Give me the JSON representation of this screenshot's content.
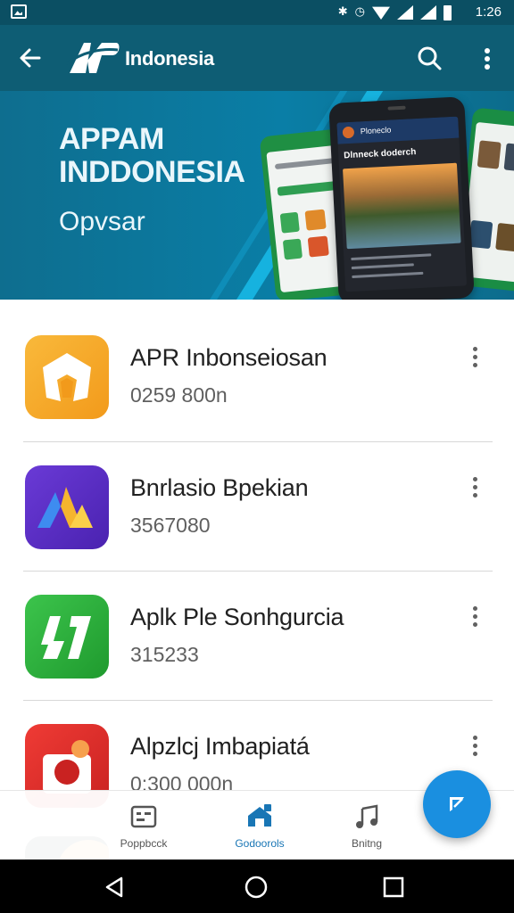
{
  "status_bar": {
    "time": "1:26",
    "icons": [
      "bluetooth-icon",
      "alarm-icon",
      "wifi-icon",
      "signal-icon",
      "battery-icon"
    ]
  },
  "app_bar": {
    "title": "Indonesia",
    "logo_text": "AP",
    "back_icon": "back-arrow-icon",
    "search_icon": "search-icon",
    "overflow_icon": "more-vert-icon"
  },
  "banner": {
    "title_line1": "APPAM",
    "title_line2": "INDDONESIA",
    "subtitle": "Opvsar",
    "phone_header": "Ploneclo",
    "phone_heading": "Dlnneck doderch"
  },
  "apps": [
    {
      "name": "APR Inbonseiosan",
      "meta": "0259 800n",
      "icon": "orange-shield-app-icon",
      "color": "#f5a623"
    },
    {
      "name": "Bnrlasio Bpekian",
      "meta": "3567080",
      "icon": "purple-triangle-app-icon",
      "color": "#5b2fc4"
    },
    {
      "name": "Aplk Ple Sonhgurcia",
      "meta": "315233",
      "icon": "green-bolt-app-icon",
      "color": "#2aae3a"
    },
    {
      "name": "Alpzlcj Imbapiatá",
      "meta": "0:300 000n",
      "icon": "red-camera-app-icon",
      "color": "#e0312e"
    }
  ],
  "bottom_nav": {
    "items": [
      {
        "label": "Poppbcck",
        "icon": "dashboard-icon"
      },
      {
        "label": "Godoorols",
        "icon": "home-store-icon"
      },
      {
        "label": "Bnitng",
        "icon": "music-note-icon"
      }
    ],
    "active_index": 1
  },
  "fab": {
    "icon": "edit-icon"
  },
  "system_nav": {
    "icons": [
      "back-triangle-icon",
      "home-circle-icon",
      "recents-square-icon"
    ]
  },
  "colors": {
    "status_bar": "#0b4f63",
    "app_bar": "#0e5d74",
    "banner": "#0a7ea6",
    "accent": "#1a8fe0"
  }
}
